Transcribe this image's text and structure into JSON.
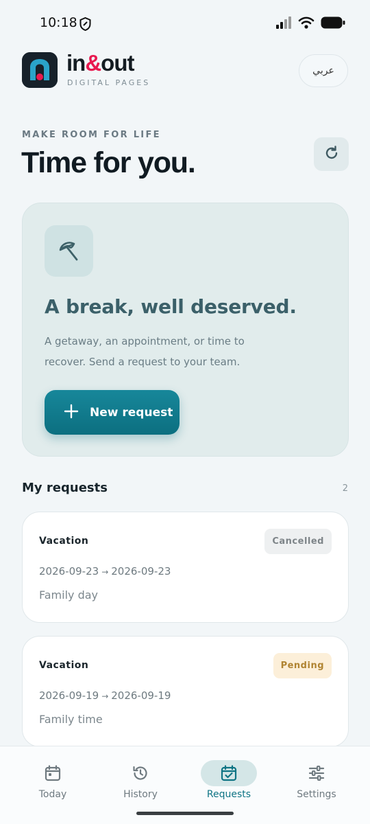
{
  "status_bar": {
    "time": "10:18",
    "icons": [
      "shield-icon",
      "signal-icon",
      "wifi-icon",
      "battery-icon"
    ]
  },
  "brand": {
    "name_part1": "in",
    "name_amp": "&",
    "name_part2": "out",
    "subtitle": "DIGITAL PAGES",
    "accent_color": "#e8194f"
  },
  "header": {
    "language_button": "عربي"
  },
  "page": {
    "eyebrow": "MAKE ROOM FOR LIFE",
    "title": "Time for you."
  },
  "hero": {
    "icon": "umbrella-icon",
    "title": "A break, well deserved.",
    "description": "A getaway, an appointment, or time to recover. Send a request to your team.",
    "button_label": "New request",
    "button_color": "#12798a"
  },
  "requests": {
    "title": "My requests",
    "count": "2",
    "items": [
      {
        "type": "Vacation",
        "status": "Cancelled",
        "start": "2026-09-23",
        "arrow": "→",
        "end": "2026-09-23",
        "note": "Family day"
      },
      {
        "type": "Vacation",
        "status": "Pending",
        "start": "2026-09-19",
        "arrow": "→",
        "end": "2026-09-19",
        "note": "Family time"
      }
    ]
  },
  "bottom_nav": {
    "items": [
      {
        "label": "Today",
        "icon": "calendar-icon",
        "active": false
      },
      {
        "label": "History",
        "icon": "history-icon",
        "active": false
      },
      {
        "label": "Requests",
        "icon": "calendar-check-icon",
        "active": true
      },
      {
        "label": "Settings",
        "icon": "sliders-icon",
        "active": false
      }
    ],
    "active_color": "#0e7484"
  }
}
